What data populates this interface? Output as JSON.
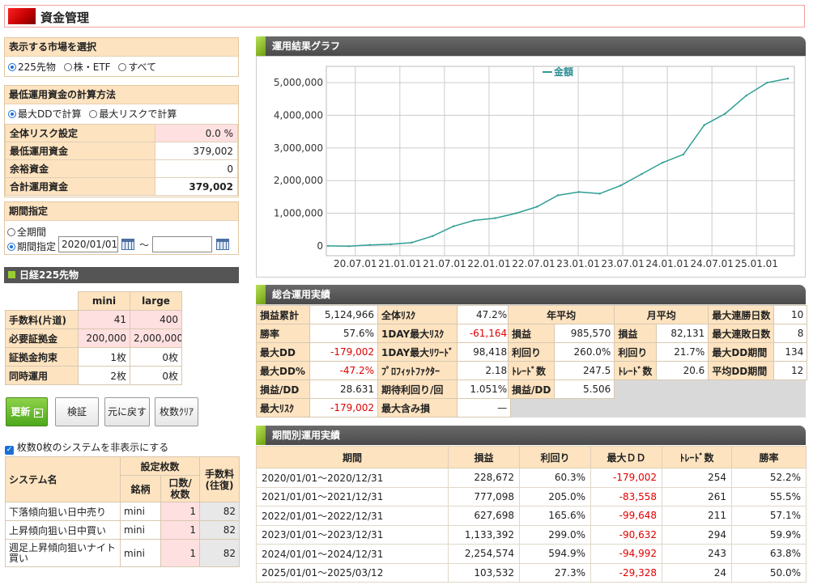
{
  "header": {
    "title": "資金管理"
  },
  "market": {
    "heading": "表示する市場を選択",
    "options": [
      "225先物",
      "株・ETF",
      "すべて"
    ]
  },
  "min_capital": {
    "heading": "最低運用資金の計算方法",
    "options": [
      "最大DDで計算",
      "最大リスクで計算"
    ],
    "rows": [
      {
        "label": "全体リスク設定",
        "value": "0.0",
        "unit": "%"
      },
      {
        "label": "最低運用資金",
        "value": "379,002"
      },
      {
        "label": "余裕資金",
        "value": "0"
      },
      {
        "label": "合計運用資金",
        "value": "379,002"
      }
    ]
  },
  "period_setting": {
    "heading": "期間指定",
    "all_label": "全期間",
    "range_label": "期間指定",
    "start_value": "2020/01/01",
    "end_value": "",
    "tilde": "～"
  },
  "nikkei": {
    "heading": "日経225先物",
    "cols": [
      "mini",
      "large"
    ],
    "rows": [
      {
        "label": "手数料(片道)",
        "mini": "41",
        "large": "400"
      },
      {
        "label": "必要証拠金",
        "mini": "200,000",
        "large": "2,000,000"
      },
      {
        "label": "証拠金拘束",
        "mini": "1枚",
        "large": "0枚"
      },
      {
        "label": "同時運用",
        "mini": "2枚",
        "large": "0枚"
      }
    ]
  },
  "buttons": {
    "update": "更新",
    "verify": "検証",
    "undo": "元に戻す",
    "clear": "枚数ｸﾘｱ"
  },
  "hide_zero": {
    "label": "枚数0枚のシステムを非表示にする"
  },
  "systems": {
    "headers": {
      "name": "システム名",
      "setting": "設定枚数",
      "fee": "手数料(往復)",
      "brand": "銘柄",
      "lots": "口数/枚数"
    },
    "rows": [
      {
        "name": "下落傾向狙い日中売り",
        "brand": "mini",
        "lots": "1",
        "fee": "82"
      },
      {
        "name": "上昇傾向狙い日中買い",
        "brand": "mini",
        "lots": "1",
        "fee": "82"
      },
      {
        "name": "週足上昇傾向狙いナイト買い",
        "brand": "mini",
        "lots": "1",
        "fee": "82"
      }
    ]
  },
  "graph": {
    "heading": "運用結果グラフ",
    "legend": "金額",
    "line_color": "#2e9e94"
  },
  "chart_data": {
    "type": "line",
    "title": "",
    "series": [
      {
        "name": "金額",
        "x": [
          "2019.10",
          "2020.01",
          "2020.04",
          "2020.07",
          "2020.10",
          "2021.01",
          "2021.04",
          "2021.07",
          "2021.10",
          "2022.01",
          "2022.04",
          "2022.07",
          "2022.10",
          "2023.01",
          "2023.04",
          "2023.07",
          "2023.10",
          "2024.01",
          "2024.04",
          "2024.07",
          "2024.10",
          "2025.01",
          "2025.03"
        ],
        "values": [
          0,
          -10000,
          30000,
          50000,
          100000,
          300000,
          600000,
          780000,
          850000,
          1000000,
          1200000,
          1550000,
          1650000,
          1600000,
          1850000,
          2200000,
          2550000,
          2800000,
          3700000,
          4050000,
          4600000,
          5000000,
          5124966
        ]
      }
    ],
    "x_tick_labels": [
      "20.07.01",
      "21.01.01",
      "21.07.01",
      "22.01.01",
      "22.07.01",
      "23.01.01",
      "23.07.01",
      "24.01.01",
      "24.07.01",
      "25.01.01"
    ],
    "y_tick_labels": [
      "0",
      "1,000,000",
      "2,000,000",
      "3,000,000",
      "4,000,000",
      "5,000,000"
    ],
    "ylim": [
      -300000,
      5500000
    ],
    "grid": true,
    "legend_position": "top-center"
  },
  "summary": {
    "heading": "総合運用実績",
    "c1": [
      {
        "label": "損益累計",
        "value": "5,124,966",
        "red": false
      },
      {
        "label": "勝率",
        "value": "57.6%",
        "red": false
      },
      {
        "label": "最大DD",
        "value": "-179,002",
        "red": true
      },
      {
        "label": "最大DD%",
        "value": "-47.2%",
        "red": true
      },
      {
        "label": "損益/DD",
        "value": "28.631",
        "red": false
      },
      {
        "label": "最大ﾘｽｸ",
        "value": "-179,002",
        "red": true
      }
    ],
    "c2": [
      {
        "label": "全体ﾘｽｸ",
        "value": "47.2%",
        "red": false
      },
      {
        "label": "1DAY最大ﾘｽｸ",
        "value": "-61,164",
        "red": true
      },
      {
        "label": "1DAY最大ﾘﾜｰﾄﾞ",
        "value": "98,418",
        "red": false
      },
      {
        "label": "ﾌﾟﾛﾌｨｯﾄﾌｧｸﾀｰ",
        "value": "2.18",
        "red": false
      },
      {
        "label": "期待利回り/回",
        "value": "1.051%",
        "red": false
      },
      {
        "label": "最大含み損",
        "value": "—",
        "red": false
      }
    ],
    "year_avg": {
      "heading": "年平均",
      "rows": [
        {
          "label": "損益",
          "value": "985,570"
        },
        {
          "label": "利回り",
          "value": "260.0%"
        },
        {
          "label": "ﾄﾚｰﾄﾞ数",
          "value": "247.5"
        },
        {
          "label": "損益/DD",
          "value": "5.506"
        }
      ]
    },
    "month_avg": {
      "heading": "月平均",
      "rows": [
        {
          "label": "損益",
          "value": "82,131"
        },
        {
          "label": "利回り",
          "value": "21.7%"
        },
        {
          "label": "ﾄﾚｰﾄﾞ数",
          "value": "20.6"
        }
      ]
    },
    "c5": [
      {
        "label": "最大連勝日数",
        "value": "10"
      },
      {
        "label": "最大連敗日数",
        "value": "8"
      },
      {
        "label": "最大DD期間",
        "value": "134"
      },
      {
        "label": "平均DD期間",
        "value": "12"
      }
    ]
  },
  "periodic": {
    "heading": "期間別運用実績",
    "headers": [
      "期間",
      "損益",
      "利回り",
      "最大ＤＤ",
      "ﾄﾚｰﾄﾞ数",
      "勝率"
    ],
    "rows": [
      {
        "period": "2020/01/01～2020/12/31",
        "pl": "228,672",
        "ret": "60.3%",
        "dd": "-179,002",
        "trades": "254",
        "win": "52.2%"
      },
      {
        "period": "2021/01/01～2021/12/31",
        "pl": "777,098",
        "ret": "205.0%",
        "dd": "-83,558",
        "trades": "261",
        "win": "55.5%"
      },
      {
        "period": "2022/01/01～2022/12/31",
        "pl": "627,698",
        "ret": "165.6%",
        "dd": "-99,648",
        "trades": "211",
        "win": "57.1%"
      },
      {
        "period": "2023/01/01～2023/12/31",
        "pl": "1,133,392",
        "ret": "299.0%",
        "dd": "-90,632",
        "trades": "294",
        "win": "59.9%"
      },
      {
        "period": "2024/01/01～2024/12/31",
        "pl": "2,254,574",
        "ret": "594.9%",
        "dd": "-94,992",
        "trades": "243",
        "win": "63.8%"
      },
      {
        "period": "2025/01/01～2025/03/12",
        "pl": "103,532",
        "ret": "27.3%",
        "dd": "-29,328",
        "trades": "24",
        "win": "50.0%"
      }
    ]
  }
}
